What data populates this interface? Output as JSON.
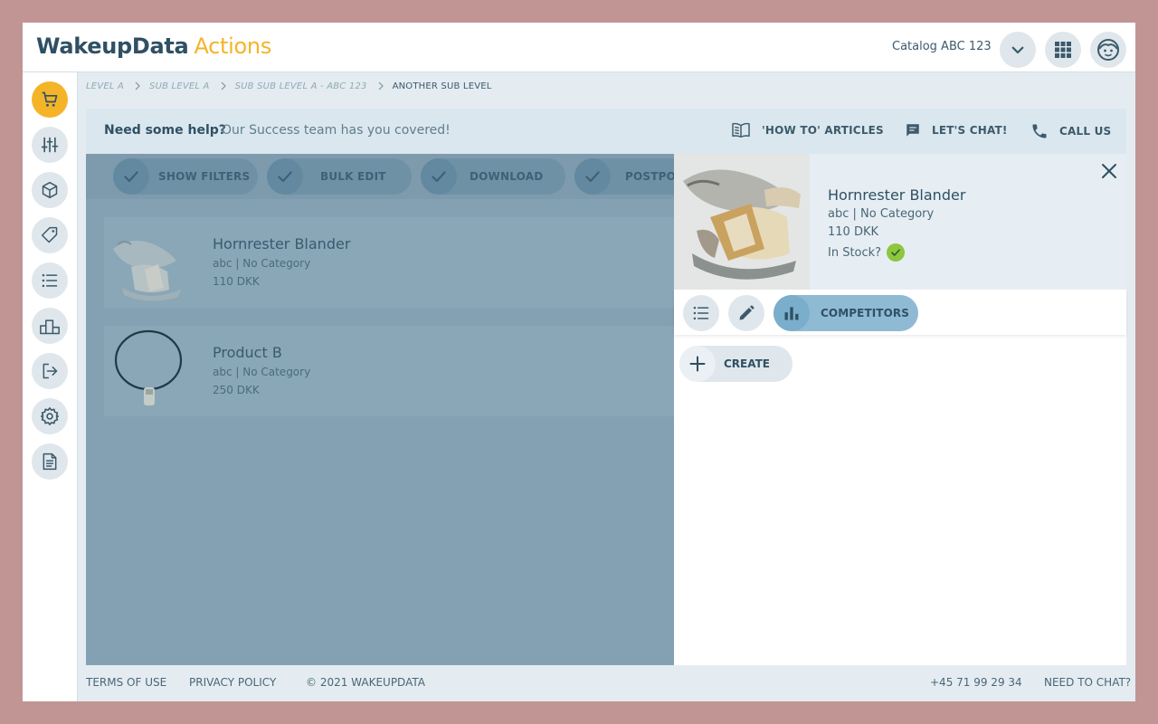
{
  "header": {
    "logo_primary": "WakeupData",
    "logo_secondary": "Actions",
    "catalog_name": "Catalog ABC 123",
    "icons": [
      "chevron-down-icon",
      "apps-grid-icon",
      "user-avatar-icon"
    ]
  },
  "sidebar": {
    "items": [
      {
        "icon": "cart-icon",
        "active": true
      },
      {
        "icon": "sliders-icon",
        "active": false
      },
      {
        "icon": "box-icon",
        "active": false
      },
      {
        "icon": "tag-icon",
        "active": false
      },
      {
        "icon": "list-icon",
        "active": false
      },
      {
        "icon": "podium-icon",
        "active": false
      },
      {
        "icon": "logout-icon",
        "active": false
      },
      {
        "icon": "gear-icon",
        "active": false
      },
      {
        "icon": "document-icon",
        "active": false
      }
    ]
  },
  "breadcrumb": {
    "items": [
      "LEVEL A",
      "SUB LEVEL A",
      "SUB SUB LEVEL A - ABC 123",
      "ANOTHER SUB LEVEL"
    ]
  },
  "help": {
    "question": "Need some help?",
    "subtitle": "Our Success team has you covered!",
    "articles": "'HOW TO' ARTICLES",
    "chat": "LET'S CHAT!",
    "call": "CALL US"
  },
  "actions": {
    "show_filters": "SHOW FILTERS",
    "bulk_edit": "BULK EDIT",
    "download": "DOWNLOAD",
    "postpone": "POSTPONE"
  },
  "products": [
    {
      "name": "Hornrester Blander",
      "category": "abc | No Category",
      "price": "110 DKK"
    },
    {
      "name": "Product B",
      "category": "abc | No Category",
      "price": "250 DKK"
    }
  ],
  "detail": {
    "name": "Hornrester Blander",
    "category": "abc | No Category",
    "price": "110 DKK",
    "stock_label": "In Stock?",
    "in_stock": true,
    "competitors_label": "COMPETITORS",
    "create_label": "CREATE"
  },
  "footer": {
    "terms": "TERMS OF USE",
    "privacy": "PRIVACY POLICY",
    "copyright": "©  2021 WAKEUPDATA",
    "phone": "+45 71 99 29 34",
    "need_chat": "NEED TO CHAT?"
  },
  "colors": {
    "accent": "#f4b428",
    "brand": "#2f5064",
    "success": "#8dc63f",
    "selected_tab": "#8fbad4"
  }
}
